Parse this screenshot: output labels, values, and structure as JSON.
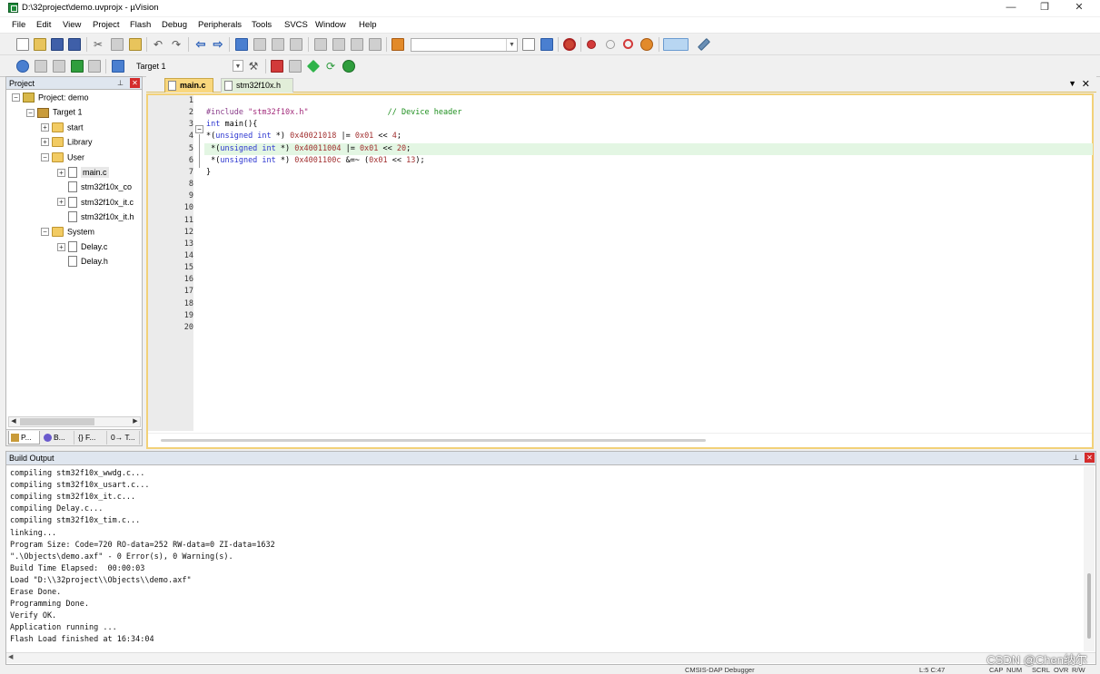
{
  "window": {
    "title": "D:\\32project\\demo.uvprojx - µVision",
    "minimize": "—",
    "maximize": "❐",
    "close": "✕"
  },
  "menu": [
    "File",
    "Edit",
    "View",
    "Project",
    "Flash",
    "Debug",
    "Peripherals",
    "Tools",
    "SVCS",
    "Window",
    "Help"
  ],
  "toolbar2": {
    "target": "Target 1"
  },
  "project_panel": {
    "title": "Project",
    "tree": [
      {
        "label": "Project: demo",
        "depth": 0,
        "expander": "−",
        "icon": "proj"
      },
      {
        "label": "Target 1",
        "depth": 1,
        "expander": "−",
        "icon": "target"
      },
      {
        "label": "start",
        "depth": 2,
        "expander": "+",
        "icon": "folder"
      },
      {
        "label": "Library",
        "depth": 2,
        "expander": "+",
        "icon": "folder"
      },
      {
        "label": "User",
        "depth": 2,
        "expander": "−",
        "icon": "folder"
      },
      {
        "label": "main.c",
        "depth": 3,
        "expander": "+",
        "icon": "file",
        "selected": true
      },
      {
        "label": "stm32f10x_co",
        "depth": 3,
        "expander": "",
        "icon": "file"
      },
      {
        "label": "stm32f10x_it.c",
        "depth": 3,
        "expander": "+",
        "icon": "file"
      },
      {
        "label": "stm32f10x_it.h",
        "depth": 3,
        "expander": "",
        "icon": "file"
      },
      {
        "label": "System",
        "depth": 2,
        "expander": "−",
        "icon": "folder"
      },
      {
        "label": "Delay.c",
        "depth": 3,
        "expander": "+",
        "icon": "file"
      },
      {
        "label": "Delay.h",
        "depth": 3,
        "expander": "",
        "icon": "file"
      }
    ],
    "tabs": [
      "P...",
      "B...",
      "{} F...",
      "0→ T..."
    ]
  },
  "editor": {
    "tabs": [
      {
        "label": "main.c",
        "active": true
      },
      {
        "label": "stm32f10x.h",
        "active": false
      }
    ],
    "line_numbers": [
      "1",
      "2",
      "3",
      "4",
      "5",
      "6",
      "7",
      "8",
      "9",
      "10",
      "11",
      "12",
      "13",
      "14",
      "15",
      "16",
      "17",
      "18",
      "19",
      "20"
    ],
    "code": [
      [],
      [
        {
          "t": "#include ",
          "c": "c-pre"
        },
        {
          "t": "\"stm32f10x.h\"",
          "c": "c-str"
        },
        {
          "t": "                 ",
          "c": "c-plain"
        },
        {
          "t": "// Device header",
          "c": "c-cmt"
        }
      ],
      [
        {
          "t": "int",
          "c": "c-kw"
        },
        {
          "t": " main",
          "c": "c-plain"
        },
        {
          "t": "(){",
          "c": "c-plain"
        }
      ],
      [
        {
          "t": "*(",
          "c": "c-plain"
        },
        {
          "t": "unsigned int",
          "c": "c-kw"
        },
        {
          "t": " *) ",
          "c": "c-plain"
        },
        {
          "t": "0x40021018",
          "c": "c-num"
        },
        {
          "t": " |= ",
          "c": "c-plain"
        },
        {
          "t": "0x01",
          "c": "c-num"
        },
        {
          "t": " << ",
          "c": "c-plain"
        },
        {
          "t": "4",
          "c": "c-num"
        },
        {
          "t": ";",
          "c": "c-plain"
        }
      ],
      [
        {
          "t": " *(",
          "c": "c-plain"
        },
        {
          "t": "unsigned int",
          "c": "c-kw"
        },
        {
          "t": " *) ",
          "c": "c-plain"
        },
        {
          "t": "0x40011004",
          "c": "c-num"
        },
        {
          "t": " |= ",
          "c": "c-plain"
        },
        {
          "t": "0x01",
          "c": "c-num"
        },
        {
          "t": " << ",
          "c": "c-plain"
        },
        {
          "t": "20",
          "c": "c-num"
        },
        {
          "t": ";",
          "c": "c-plain"
        }
      ],
      [
        {
          "t": " *(",
          "c": "c-plain"
        },
        {
          "t": "unsigned int",
          "c": "c-kw"
        },
        {
          "t": " *) ",
          "c": "c-plain"
        },
        {
          "t": "0x4001100c",
          "c": "c-num"
        },
        {
          "t": " &=~ (",
          "c": "c-plain"
        },
        {
          "t": "0x01",
          "c": "c-num"
        },
        {
          "t": " << ",
          "c": "c-plain"
        },
        {
          "t": "13",
          "c": "c-num"
        },
        {
          "t": ");",
          "c": "c-plain"
        }
      ],
      [
        {
          "t": "}",
          "c": "c-plain"
        }
      ]
    ],
    "highlighted_line": 5
  },
  "build_output": {
    "title": "Build Output",
    "lines": [
      "compiling stm32f10x_wwdg.c...",
      "compiling stm32f10x_usart.c...",
      "compiling stm32f10x_it.c...",
      "compiling Delay.c...",
      "compiling stm32f10x_tim.c...",
      "linking...",
      "Program Size: Code=720 RO-data=252 RW-data=0 ZI-data=1632",
      "\".\\Objects\\demo.axf\" - 0 Error(s), 0 Warning(s).",
      "Build Time Elapsed:  00:00:03",
      "Load \"D:\\\\32project\\\\Objects\\\\demo.axf\"",
      "Erase Done.",
      "Programming Done.",
      "Verify OK.",
      "Application running ...",
      "Flash Load finished at 16:34:04"
    ]
  },
  "statusbar": {
    "debugger": "CMSIS-DAP Debugger",
    "position": "L:5 C:47",
    "indicators": [
      "CAP",
      "NUM",
      "SCRL",
      "OVR",
      "R/W"
    ]
  },
  "watermark": "CSDN @Chen纳尔"
}
